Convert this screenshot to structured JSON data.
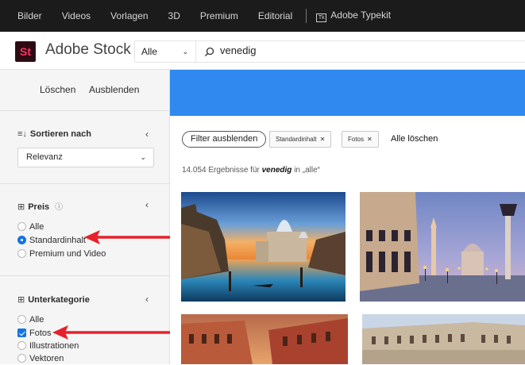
{
  "topnav": {
    "items": [
      "Bilder",
      "Videos",
      "Vorlagen",
      "3D",
      "Premium",
      "Editorial"
    ],
    "typekit_icon": "Tk",
    "typekit": "Adobe Typekit"
  },
  "header": {
    "logo": "St",
    "brand": "Adobe Stock",
    "scope": "Alle",
    "search_value": "venedig"
  },
  "sidebar": {
    "clear_label": "Löschen",
    "hide_label": "Ausblenden",
    "sort": {
      "title": "Sortieren nach",
      "selected": "Relevanz"
    },
    "price": {
      "title": "Preis",
      "options": [
        {
          "label": "Alle",
          "checked": false
        },
        {
          "label": "Standardinhalt",
          "checked": true
        },
        {
          "label": "Premium und Video",
          "checked": false
        }
      ]
    },
    "subcategory": {
      "title": "Unterkategorie",
      "options": [
        {
          "label": "Alle",
          "checked": false
        },
        {
          "label": "Fotos",
          "checked": true
        },
        {
          "label": "Illustrationen",
          "checked": false
        },
        {
          "label": "Vektoren",
          "checked": false
        }
      ]
    }
  },
  "annotation_color": "#e8202a",
  "main": {
    "hide_filters_label": "Filter ausblenden",
    "active_filters": [
      "Standardinhalt",
      "Fotos"
    ],
    "clear_all_label": "Alle löschen",
    "results_count": "14.054 Ergebnisse für",
    "results_term": "venedig",
    "results_scope": "in „alle“"
  }
}
